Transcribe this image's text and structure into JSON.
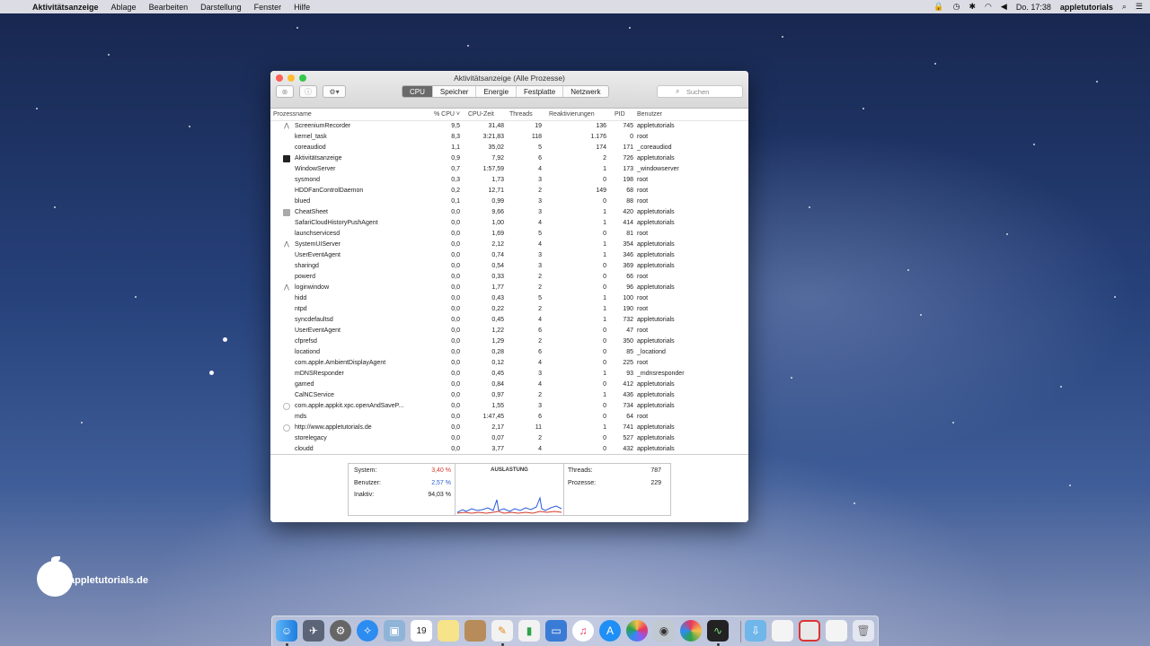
{
  "menubar": {
    "apple_glyph": "",
    "app_name": "Aktivitätsanzeige",
    "menus": [
      "Ablage",
      "Bearbeiten",
      "Darstellung",
      "Fenster",
      "Hilfe"
    ],
    "clock": "Do. 17:38",
    "user": "appletutorials",
    "status_icons": [
      "lock-icon",
      "time-machine-icon",
      "bluetooth-icon",
      "wifi-icon",
      "volume-icon",
      "search-icon",
      "notification-center-icon"
    ]
  },
  "window": {
    "title": "Aktivitätsanzeige (Alle Prozesse)",
    "tabs": [
      {
        "label": "CPU",
        "active": true
      },
      {
        "label": "Speicher",
        "active": false
      },
      {
        "label": "Energie",
        "active": false
      },
      {
        "label": "Festplatte",
        "active": false
      },
      {
        "label": "Netzwerk",
        "active": false
      }
    ],
    "search_placeholder": "Suchen"
  },
  "table": {
    "columns": {
      "name": "Prozessname",
      "cpu": "% CPU",
      "time": "CPU-Zeit",
      "threads": "Threads",
      "react": "Reaktivierungen",
      "pid": "PID",
      "user": "Benutzer"
    },
    "rows": [
      {
        "icon": "screenium-icon",
        "name": "ScreeniumRecorder",
        "cpu": "9,5",
        "time": "31,48",
        "threads": "19",
        "react": "136",
        "pid": "745",
        "user": "appletutorials"
      },
      {
        "icon": "",
        "name": "kernel_task",
        "cpu": "8,3",
        "time": "3:21,83",
        "threads": "118",
        "react": "1.176",
        "pid": "0",
        "user": "root"
      },
      {
        "icon": "",
        "name": "coreaudiod",
        "cpu": "1,1",
        "time": "35,02",
        "threads": "5",
        "react": "174",
        "pid": "171",
        "user": "_coreaudiod"
      },
      {
        "icon": "activity-monitor-icon",
        "name": "Aktivitätsanzeige",
        "cpu": "0,9",
        "time": "7,92",
        "threads": "6",
        "react": "2",
        "pid": "726",
        "user": "appletutorials"
      },
      {
        "icon": "",
        "name": "WindowServer",
        "cpu": "0,7",
        "time": "1:57,59",
        "threads": "4",
        "react": "1",
        "pid": "173",
        "user": "_windowserver"
      },
      {
        "icon": "",
        "name": "sysmond",
        "cpu": "0,3",
        "time": "1,73",
        "threads": "3",
        "react": "0",
        "pid": "198",
        "user": "root"
      },
      {
        "icon": "",
        "name": "HDDFanControlDaemon",
        "cpu": "0,2",
        "time": "12,71",
        "threads": "2",
        "react": "149",
        "pid": "68",
        "user": "root"
      },
      {
        "icon": "",
        "name": "blued",
        "cpu": "0,1",
        "time": "0,99",
        "threads": "3",
        "react": "0",
        "pid": "88",
        "user": "root"
      },
      {
        "icon": "cheatsheet-icon",
        "name": "CheatSheet",
        "cpu": "0,0",
        "time": "9,66",
        "threads": "3",
        "react": "1",
        "pid": "420",
        "user": "appletutorials"
      },
      {
        "icon": "",
        "name": "SafariCloudHistoryPushAgent",
        "cpu": "0,0",
        "time": "1,00",
        "threads": "4",
        "react": "1",
        "pid": "414",
        "user": "appletutorials"
      },
      {
        "icon": "",
        "name": "launchservicesd",
        "cpu": "0,0",
        "time": "1,69",
        "threads": "5",
        "react": "0",
        "pid": "81",
        "user": "root"
      },
      {
        "icon": "system-ui-server-icon",
        "name": "SystemUIServer",
        "cpu": "0,0",
        "time": "2,12",
        "threads": "4",
        "react": "1",
        "pid": "354",
        "user": "appletutorials"
      },
      {
        "icon": "",
        "name": "UserEventAgent",
        "cpu": "0,0",
        "time": "0,74",
        "threads": "3",
        "react": "1",
        "pid": "346",
        "user": "appletutorials"
      },
      {
        "icon": "",
        "name": "sharingd",
        "cpu": "0,0",
        "time": "0,54",
        "threads": "3",
        "react": "0",
        "pid": "369",
        "user": "appletutorials"
      },
      {
        "icon": "",
        "name": "powerd",
        "cpu": "0,0",
        "time": "0,33",
        "threads": "2",
        "react": "0",
        "pid": "66",
        "user": "root"
      },
      {
        "icon": "loginwindow-icon",
        "name": "loginwindow",
        "cpu": "0,0",
        "time": "1,77",
        "threads": "2",
        "react": "0",
        "pid": "96",
        "user": "appletutorials"
      },
      {
        "icon": "",
        "name": "hidd",
        "cpu": "0,0",
        "time": "0,43",
        "threads": "5",
        "react": "1",
        "pid": "100",
        "user": "root"
      },
      {
        "icon": "",
        "name": "ntpd",
        "cpu": "0,0",
        "time": "0,22",
        "threads": "2",
        "react": "1",
        "pid": "190",
        "user": "root"
      },
      {
        "icon": "",
        "name": "syncdefaultsd",
        "cpu": "0,0",
        "time": "0,45",
        "threads": "4",
        "react": "1",
        "pid": "732",
        "user": "appletutorials"
      },
      {
        "icon": "",
        "name": "UserEventAgent",
        "cpu": "0,0",
        "time": "1,22",
        "threads": "6",
        "react": "0",
        "pid": "47",
        "user": "root"
      },
      {
        "icon": "",
        "name": "cfprefsd",
        "cpu": "0,0",
        "time": "1,29",
        "threads": "2",
        "react": "0",
        "pid": "350",
        "user": "appletutorials"
      },
      {
        "icon": "",
        "name": "locationd",
        "cpu": "0,0",
        "time": "0,28",
        "threads": "6",
        "react": "0",
        "pid": "85",
        "user": "_locationd"
      },
      {
        "icon": "",
        "name": "com.apple.AmbientDisplayAgent",
        "cpu": "0,0",
        "time": "0,12",
        "threads": "4",
        "react": "0",
        "pid": "225",
        "user": "root"
      },
      {
        "icon": "",
        "name": "mDNSResponder",
        "cpu": "0,0",
        "time": "0,45",
        "threads": "3",
        "react": "1",
        "pid": "93",
        "user": "_mdnsresponder"
      },
      {
        "icon": "",
        "name": "gamed",
        "cpu": "0,0",
        "time": "0,84",
        "threads": "4",
        "react": "0",
        "pid": "412",
        "user": "appletutorials"
      },
      {
        "icon": "",
        "name": "CalNCService",
        "cpu": "0,0",
        "time": "0,97",
        "threads": "2",
        "react": "1",
        "pid": "436",
        "user": "appletutorials"
      },
      {
        "icon": "generic-app-icon",
        "name": "com.apple.appkit.xpc.openAndSaveP...",
        "cpu": "0,0",
        "time": "1,55",
        "threads": "3",
        "react": "0",
        "pid": "734",
        "user": "appletutorials"
      },
      {
        "icon": "",
        "name": "mds",
        "cpu": "0,0",
        "time": "1:47,45",
        "threads": "6",
        "react": "0",
        "pid": "64",
        "user": "root"
      },
      {
        "icon": "generic-app-icon",
        "name": "http://www.appletutorials.de",
        "cpu": "0,0",
        "time": "2,17",
        "threads": "11",
        "react": "1",
        "pid": "741",
        "user": "appletutorials"
      },
      {
        "icon": "",
        "name": "storelegacy",
        "cpu": "0,0",
        "time": "0,07",
        "threads": "2",
        "react": "0",
        "pid": "527",
        "user": "appletutorials"
      },
      {
        "icon": "",
        "name": "cloudd",
        "cpu": "0,0",
        "time": "3,77",
        "threads": "4",
        "react": "0",
        "pid": "432",
        "user": "appletutorials"
      }
    ]
  },
  "summary": {
    "system_label": "System:",
    "system_value": "3,40 %",
    "user_label": "Benutzer:",
    "user_value": "2,57 %",
    "idle_label": "Inaktiv:",
    "idle_value": "94,03 %",
    "graph_title": "AUSLASTUNG",
    "threads_label": "Threads:",
    "threads_value": "787",
    "processes_label": "Prozesse:",
    "processes_value": "229",
    "colors": {
      "system": "#d43a2b",
      "user": "#2a5bd7"
    }
  },
  "logo": {
    "text": "appletutorials.de"
  },
  "dock": {
    "apps": [
      "finder-icon",
      "launchpad-icon",
      "system-preferences-icon",
      "safari-icon",
      "preview-icon",
      "calendar-icon",
      "notes-icon",
      "contacts-icon",
      "pages-icon",
      "numbers-icon",
      "keynote-icon",
      "itunes-icon",
      "app-store-icon",
      "photos-icon",
      "photo-booth-icon",
      "colorsync-icon",
      "activity-monitor-icon"
    ],
    "calendar_day": "19",
    "folders": [
      "downloads-folder-icon",
      "documents-stack-icon",
      "screenshots-stack-icon",
      "files-stack-icon",
      "trash-icon"
    ]
  }
}
